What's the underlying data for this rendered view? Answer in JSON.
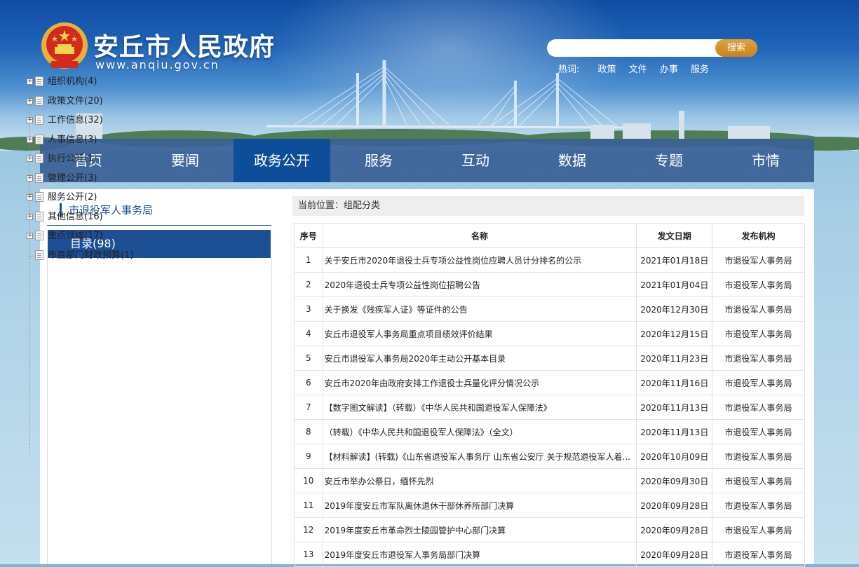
{
  "header": {
    "site_title": "安丘市人民政府",
    "site_url": "www.anqiu.gov.cn",
    "emblem_icon": "national-emblem-icon",
    "search": {
      "placeholder": "",
      "button_label": "搜索"
    },
    "hotwords_label": "热词:",
    "hotwords": [
      "政策",
      "文件",
      "办事",
      "服务"
    ]
  },
  "nav": {
    "items": [
      "首页",
      "要闻",
      "政务公开",
      "服务",
      "互动",
      "数据",
      "专题",
      "市情"
    ],
    "active_index": 2
  },
  "sidebar": {
    "title": "市退役军人事务局",
    "category_label": "目录(98)",
    "tree": [
      {
        "label": "组织机构(4)"
      },
      {
        "label": "政策文件(20)"
      },
      {
        "label": "工作信息(32)"
      },
      {
        "label": "人事信息(3)"
      },
      {
        "label": "执行公开(1)"
      },
      {
        "label": "管理公开(3)"
      },
      {
        "label": "服务公开(2)"
      },
      {
        "label": "其他信息(16)"
      },
      {
        "label": "重点领域(17)"
      },
      {
        "label": "市直部门财政预算(1)"
      }
    ]
  },
  "main": {
    "breadcrumb": "当前位置：组配分类",
    "table": {
      "headers": [
        "序号",
        "名称",
        "发文日期",
        "发布机构"
      ],
      "rows": [
        {
          "num": "1",
          "name": "关于安丘市2020年退役士兵专项公益性岗位应聘人员计分排名的公示",
          "date": "2021年01月18日",
          "org": "市退役军人事务局"
        },
        {
          "num": "2",
          "name": "2020年退役士兵专项公益性岗位招聘公告",
          "date": "2021年01月04日",
          "org": "市退役军人事务局"
        },
        {
          "num": "3",
          "name": "关于换发《残疾军人证》等证件的公告",
          "date": "2020年12月30日",
          "org": "市退役军人事务局"
        },
        {
          "num": "4",
          "name": "安丘市退役军人事务局重点项目绩效评价结果",
          "date": "2020年12月15日",
          "org": "市退役军人事务局"
        },
        {
          "num": "5",
          "name": "安丘市退役军人事务局2020年主动公开基本目录",
          "date": "2020年11月23日",
          "org": "市退役军人事务局"
        },
        {
          "num": "6",
          "name": "安丘市2020年由政府安排工作退役士兵量化评分情况公示",
          "date": "2020年11月16日",
          "org": "市退役军人事务局"
        },
        {
          "num": "7",
          "name": "【数字图文解读】（转载）《中华人民共和国退役军人保障法》",
          "date": "2020年11月13日",
          "org": "市退役军人事务局"
        },
        {
          "num": "8",
          "name": "（转载）《中华人民共和国退役军人保障法》（全文）",
          "date": "2020年11月13日",
          "org": "市退役军人事务局"
        },
        {
          "num": "9",
          "name": "【材料解读】(转载)《山东省退役军人事务厅 山东省公安厅 关于规范退役军人着...",
          "date": "2020年10月09日",
          "org": "市退役军人事务局"
        },
        {
          "num": "10",
          "name": "安丘市举办公祭日，缅怀先烈",
          "date": "2020年09月30日",
          "org": "市退役军人事务局"
        },
        {
          "num": "11",
          "name": "2019年度安丘市军队离休退休干部休养所部门决算",
          "date": "2020年09月28日",
          "org": "市退役军人事务局"
        },
        {
          "num": "12",
          "name": "2019年度安丘市革命烈士陵园管护中心部门决算",
          "date": "2020年09月28日",
          "org": "市退役军人事务局"
        },
        {
          "num": "13",
          "name": "2019年度安丘市退役军人事务局部门决算",
          "date": "2020年09月28日",
          "org": "市退役军人事务局"
        }
      ]
    }
  }
}
